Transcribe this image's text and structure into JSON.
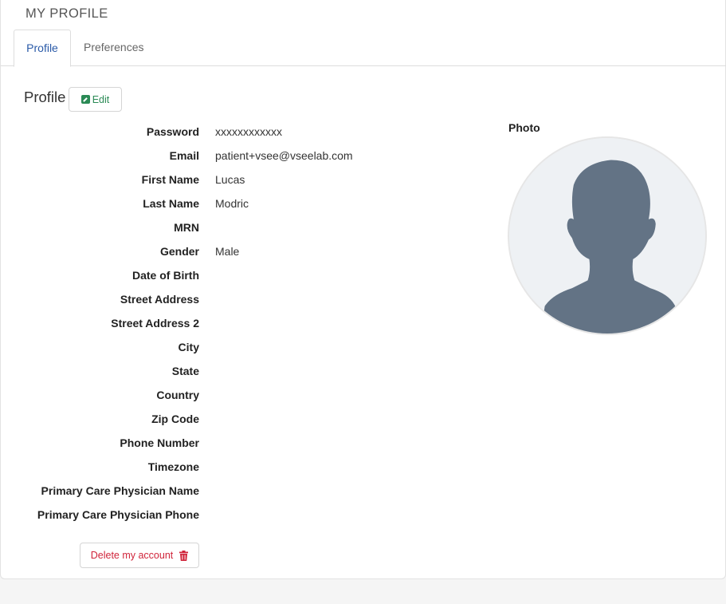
{
  "page": {
    "title": "MY PROFILE"
  },
  "tabs": [
    {
      "label": "Profile",
      "active": true
    },
    {
      "label": "Preferences",
      "active": false
    }
  ],
  "section": {
    "title": "Profile",
    "edit_label": "Edit",
    "edit_icon": "pencil-square-icon"
  },
  "fields": [
    {
      "label": "Password",
      "value": "xxxxxxxxxxxx"
    },
    {
      "label": "Email",
      "value": "patient+vsee@vseelab.com"
    },
    {
      "label": "First Name",
      "value": "Lucas"
    },
    {
      "label": "Last Name",
      "value": "Modric"
    },
    {
      "label": "MRN",
      "value": ""
    },
    {
      "label": "Gender",
      "value": "Male"
    },
    {
      "label": "Date of Birth",
      "value": ""
    },
    {
      "label": "Street Address",
      "value": ""
    },
    {
      "label": "Street Address 2",
      "value": ""
    },
    {
      "label": "City",
      "value": ""
    },
    {
      "label": "State",
      "value": ""
    },
    {
      "label": "Country",
      "value": ""
    },
    {
      "label": "Zip Code",
      "value": ""
    },
    {
      "label": "Phone Number",
      "value": ""
    },
    {
      "label": "Timezone",
      "value": ""
    },
    {
      "label": "Primary Care Physician Name",
      "value": ""
    },
    {
      "label": "Primary Care Physician Phone",
      "value": ""
    }
  ],
  "photo": {
    "label": "Photo",
    "icon": "default-avatar-icon"
  },
  "delete": {
    "label": "Delete my account",
    "icon": "trash-icon"
  },
  "colors": {
    "accent_blue": "#2a5aa8",
    "edit_green": "#2a8a55",
    "danger_red": "#d0243a",
    "avatar_fill": "#637385"
  }
}
